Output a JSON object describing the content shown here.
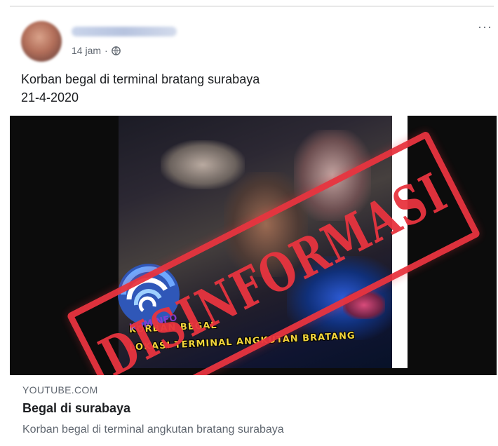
{
  "post": {
    "timestamp": "14 jam",
    "separator": "·",
    "privacy_icon": "globe-icon",
    "more_label": "···",
    "text_line1": "Korban begal di terminal bratang surabaya",
    "text_line2": "21-4-2020"
  },
  "video": {
    "caption_line1": "KORBAN BEGAL",
    "caption_line2": "LOKASI TERMINAL ANGKUTAN BRATANG",
    "logo_label": "KOMINFO"
  },
  "stamp": {
    "text": "DISINFORMASI",
    "color": "#e8343f"
  },
  "link": {
    "domain": "YOUTUBE.COM",
    "title": "Begal di surabaya",
    "description": "Korban begal di terminal angkutan bratang surabaya"
  }
}
